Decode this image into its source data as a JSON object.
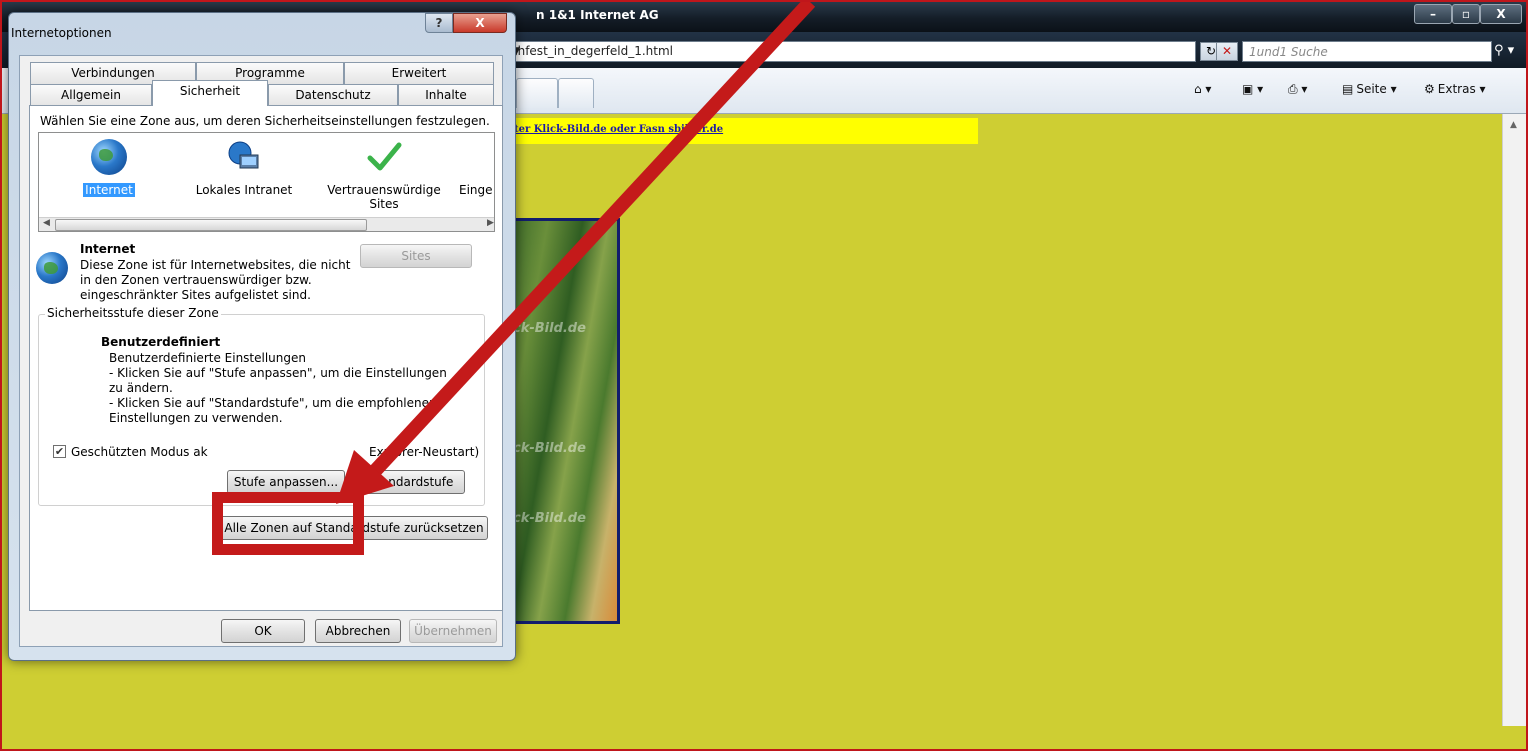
{
  "browser": {
    "window_title_visible": "n 1&1 Internet AG",
    "address_value": "chfest_in_degerfeld_1.html",
    "search_placeholder": "1und1 Suche",
    "commands": {
      "page": "Seite",
      "tools": "Extras"
    }
  },
  "page": {
    "link_text": "ter Klick-Bild.de oder Fasn     sbilder.de",
    "watermark": "ck-Bild.de",
    "watermark2": "ck-Bild.de",
    "watermark3": "ck-Bild.de",
    "background_color": "#cece33"
  },
  "dialog": {
    "title": "Internetoptionen",
    "tabs_row1": [
      "Verbindungen",
      "Programme",
      "Erweitert"
    ],
    "tabs_row2": [
      "Allgemein",
      "Sicherheit",
      "Datenschutz",
      "Inhalte"
    ],
    "active_tab": "Sicherheit",
    "zone_prompt": "Wählen Sie eine Zone aus, um deren Sicherheitseinstellungen festzulegen.",
    "zones": [
      {
        "label": "Internet",
        "icon": "globe-icon",
        "selected": true
      },
      {
        "label": "Lokales Intranet",
        "icon": "intranet-icon",
        "selected": false
      },
      {
        "label": "Vertrauenswürdige\nSites",
        "icon": "checkmark-icon",
        "selected": false
      },
      {
        "label": "Einge",
        "icon": "blocked-icon",
        "selected": false
      }
    ],
    "zone_info": {
      "name": "Internet",
      "description": "Diese Zone ist für Internetwebsites, die nicht in den Zonen vertrauenswürdiger bzw. eingeschränkter Sites aufgelistet sind.",
      "sites_button": "Sites"
    },
    "security_level": {
      "group_label": "Sicherheitsstufe dieser Zone",
      "level_name": "Benutzerdefiniert",
      "line1": "Benutzerdefinierte Einstellungen",
      "line2": "- Klicken Sie auf \"Stufe anpassen\", um die Einstellungen zu ändern.",
      "line3": "- Klicken Sie auf \"Standardstufe\", um die empfohlenen Einstellungen zu verwenden.",
      "protected_mode_label": "Geschützten Modus ak",
      "protected_mode_suffix": "Explorer-Neustart)",
      "protected_mode_checked": true,
      "custom_level_button": "Stufe anpassen...",
      "default_level_button": "Standardstufe"
    },
    "reset_all_button": "Alle Zonen auf Standardstufe zurücksetzen",
    "ok_button": "OK",
    "cancel_button": "Abbrechen",
    "apply_button": "Übernehmen"
  },
  "annotation": {
    "color": "#c41a1a"
  }
}
